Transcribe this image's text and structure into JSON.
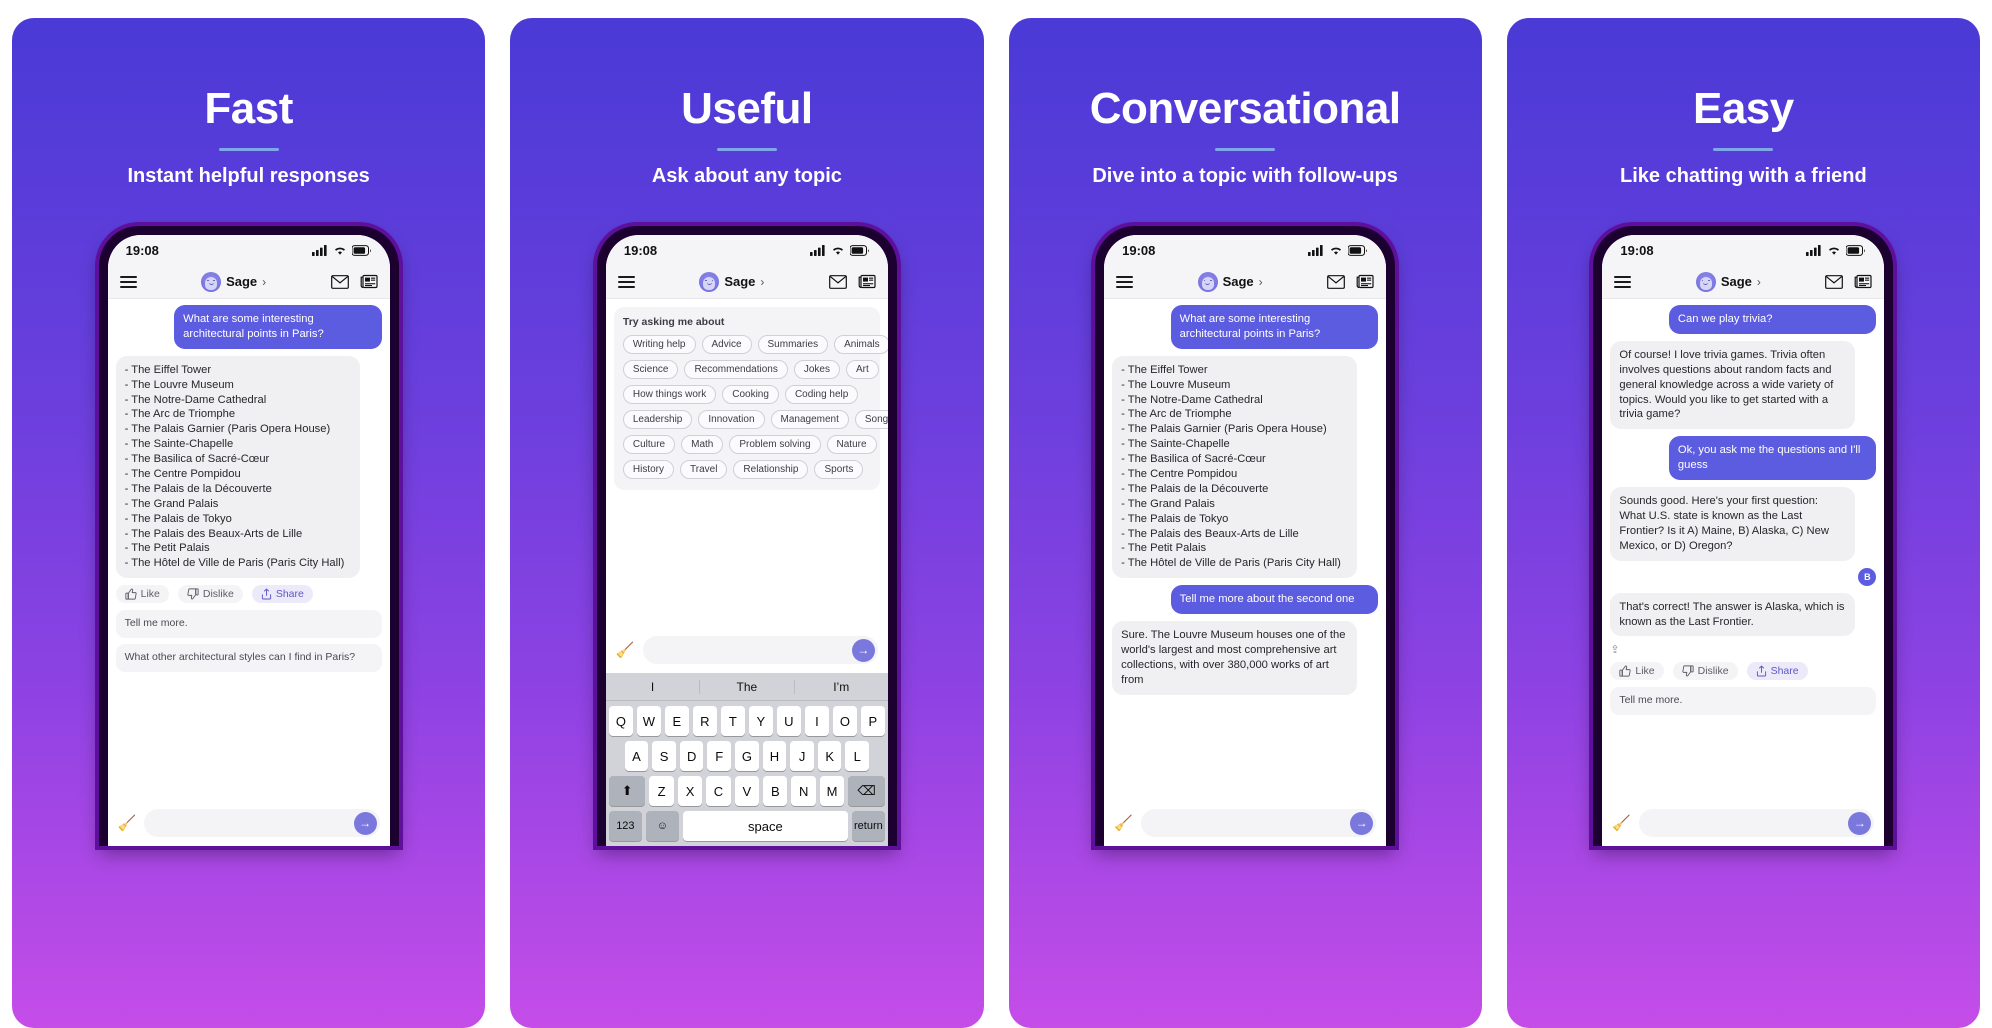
{
  "brand": {
    "accent": "#5c5ce0",
    "bg_gradient_start": "#4a3ad6",
    "bg_gradient_end": "#c54de8",
    "rule_color": "#7ea8e8"
  },
  "status": {
    "time": "19:08",
    "signal_icon": "cellular-signal-icon",
    "wifi_icon": "wifi-icon",
    "battery_icon": "battery-icon"
  },
  "nav": {
    "menu_icon": "hamburger-menu-icon",
    "bot_name": "Sage",
    "chevron": "›",
    "mail_icon": "envelope-icon",
    "feed_icon": "news-feed-icon",
    "avatar_icon": "sage-avatar-icon"
  },
  "feedback": {
    "like": "Like",
    "dislike": "Dislike",
    "share": "Share",
    "like_icon": "thumbs-up-icon",
    "dislike_icon": "thumbs-down-icon",
    "share_icon": "share-icon"
  },
  "composer": {
    "broom_icon": "broom-clear-icon",
    "send_icon": "arrow-right-send-icon",
    "placeholder": ""
  },
  "panels": [
    {
      "title": "Fast",
      "subtitle": "Instant helpful responses",
      "messages": [
        {
          "role": "user",
          "text": "What are some interesting architectural points in Paris?"
        },
        {
          "role": "bot",
          "text": "- The Eiffel Tower\n- The Louvre Museum\n- The Notre-Dame Cathedral\n- The Arc de Triomphe\n- The Palais Garnier (Paris Opera House)\n- The Sainte-Chapelle\n- The Basilica of Sacré-Cœur\n- The Centre Pompidou\n- The Palais de la Découverte\n- The Grand Palais\n- The Palais de Tokyo\n- The Palais des Beaux-Arts de Lille\n- The Petit Palais\n- The Hôtel de Ville de Paris (Paris City Hall)"
        }
      ],
      "suggestions": [
        "Tell me more.",
        "What other architectural styles can I find in Paris?"
      ]
    },
    {
      "title": "Useful",
      "subtitle": "Ask about any topic",
      "chips_title": "Try asking me about",
      "chip_rows": [
        [
          "Writing help",
          "Advice",
          "Summaries",
          "Animals"
        ],
        [
          "Science",
          "Recommendations",
          "Jokes",
          "Art"
        ],
        [
          "How things work",
          "Cooking",
          "Coding help"
        ],
        [
          "Leadership",
          "Innovation",
          "Management",
          "Songs"
        ],
        [
          "Culture",
          "Math",
          "Problem solving",
          "Nature"
        ],
        [
          "History",
          "Travel",
          "Relationship",
          "Sports"
        ]
      ],
      "keyboard": {
        "predictions": [
          "I",
          "The",
          "I’m"
        ],
        "row1": [
          "Q",
          "W",
          "E",
          "R",
          "T",
          "Y",
          "U",
          "I",
          "O",
          "P"
        ],
        "row2": [
          "A",
          "S",
          "D",
          "F",
          "G",
          "H",
          "J",
          "K",
          "L"
        ],
        "row3": [
          "Z",
          "X",
          "C",
          "V",
          "B",
          "N",
          "M"
        ],
        "shift_icon": "shift-key-icon",
        "backspace_icon": "backspace-key-icon",
        "numeric_key": "123",
        "emoji_icon": "emoji-key-icon",
        "space_key": "space",
        "return_key": "return"
      }
    },
    {
      "title": "Conversational",
      "subtitle": "Dive into a topic with follow-ups",
      "messages": [
        {
          "role": "user",
          "text": "What are some interesting architectural points in Paris?"
        },
        {
          "role": "bot",
          "text": "- The Eiffel Tower\n- The Louvre Museum\n- The Notre-Dame Cathedral\n- The Arc de Triomphe\n- The Palais Garnier (Paris Opera House)\n- The Sainte-Chapelle\n- The Basilica of Sacré-Cœur\n- The Centre Pompidou\n- The Palais de la Découverte\n- The Grand Palais\n- The Palais de Tokyo\n- The Palais des Beaux-Arts de Lille\n- The Petit Palais\n- The Hôtel de Ville de Paris (Paris City Hall)"
        },
        {
          "role": "user",
          "text": "Tell me more about the second one"
        },
        {
          "role": "bot",
          "text": "Sure. The Louvre Museum houses one of the world's largest and most comprehensive art collections, with over 380,000 works of art from"
        }
      ]
    },
    {
      "title": "Easy",
      "subtitle": "Like chatting with a friend",
      "messages": [
        {
          "role": "user",
          "text": "Can we play trivia?"
        },
        {
          "role": "bot",
          "text": "Of course! I love trivia games. Trivia often involves questions about random facts and general knowledge across a wide variety of topics. Would you like to get started with a trivia game?"
        },
        {
          "role": "user",
          "text": "Ok, you ask me the questions and I'll guess"
        },
        {
          "role": "bot",
          "text": "Sounds good. Here's your first question: What U.S. state is known as the Last Frontier? Is it A) Maine, B) Alaska, C) New Mexico, or D) Oregon?"
        },
        {
          "role": "user_badge",
          "text": "B"
        },
        {
          "role": "bot",
          "text": "That's correct! The answer is Alaska, which is known as the Last Frontier."
        }
      ],
      "suggestions": [
        "Tell me more."
      ],
      "share_mini_icon": "share-icon"
    }
  ]
}
